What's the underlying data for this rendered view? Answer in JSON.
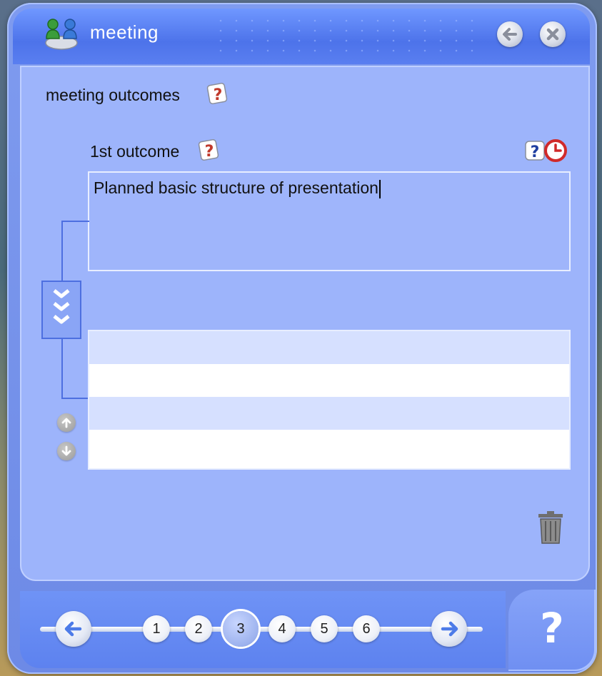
{
  "window": {
    "title": "meeting",
    "app_icon": "people-icon"
  },
  "titlebar_buttons": {
    "back_icon": "arrow-left-icon",
    "close_icon": "close-icon"
  },
  "section": {
    "label": "meeting outcomes",
    "help_icon": "help-card-icon"
  },
  "outcome": {
    "label": "1st outcome",
    "help_icon": "help-card-icon",
    "timed_help_icon": "help-clock-icon",
    "text_value": "Planned basic structure of presentation"
  },
  "list": {
    "rows": [
      "",
      "",
      "",
      ""
    ]
  },
  "controls": {
    "expand_icon": "triple-chevron-down-icon",
    "move_up_icon": "arrow-up-icon",
    "move_down_icon": "arrow-down-icon",
    "delete_icon": "trash-icon"
  },
  "pager": {
    "prev_icon": "arrow-left-icon",
    "next_icon": "arrow-right-icon",
    "pages": [
      "1",
      "2",
      "3",
      "4",
      "5",
      "6"
    ],
    "current_page": "3"
  },
  "help": {
    "label": "?"
  },
  "colors": {
    "panel": "#9db4fb",
    "titlebar": "#4d73ea",
    "accent_line": "#4d6fe0",
    "list_alt": "#d6e0ff"
  }
}
